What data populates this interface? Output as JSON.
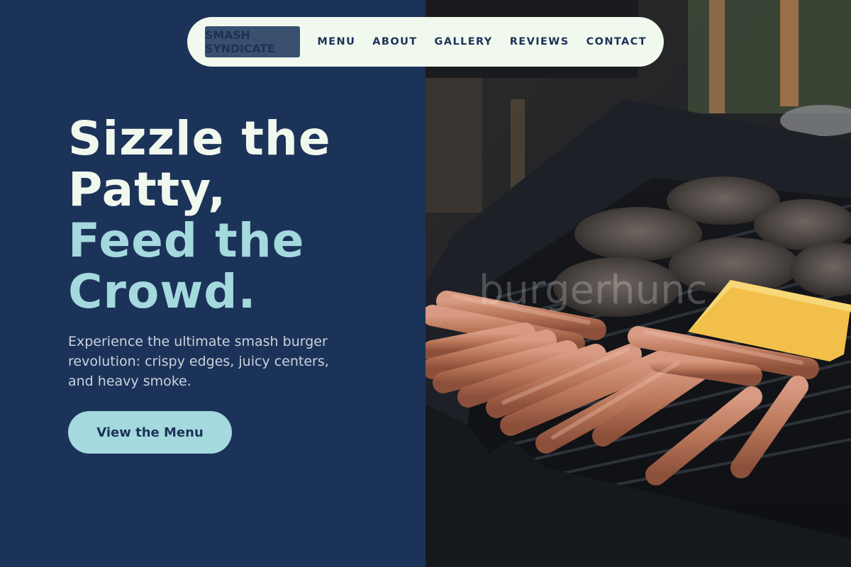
{
  "brand": {
    "logo_text": "SMASH SYNDICATE"
  },
  "nav": {
    "items": [
      "MENU",
      "ABOUT",
      "GALLERY",
      "REVIEWS",
      "CONTACT"
    ]
  },
  "hero": {
    "headline_line1": "Sizzle the Patty,",
    "headline_line2": "Feed the Crowd.",
    "subtext": "Experience the ultimate smash burger revolution: crispy edges, juicy centers, and heavy smoke.",
    "cta_label": "View the Menu"
  },
  "image": {
    "watermark_text": "burgerhunc",
    "subject": "grill-with-patties-hotdogs-cheese"
  },
  "colors": {
    "navy": "#1c3359",
    "cream": "#f1f8ee",
    "aqua": "#a4d9de",
    "logo_bg": "#39506f"
  }
}
